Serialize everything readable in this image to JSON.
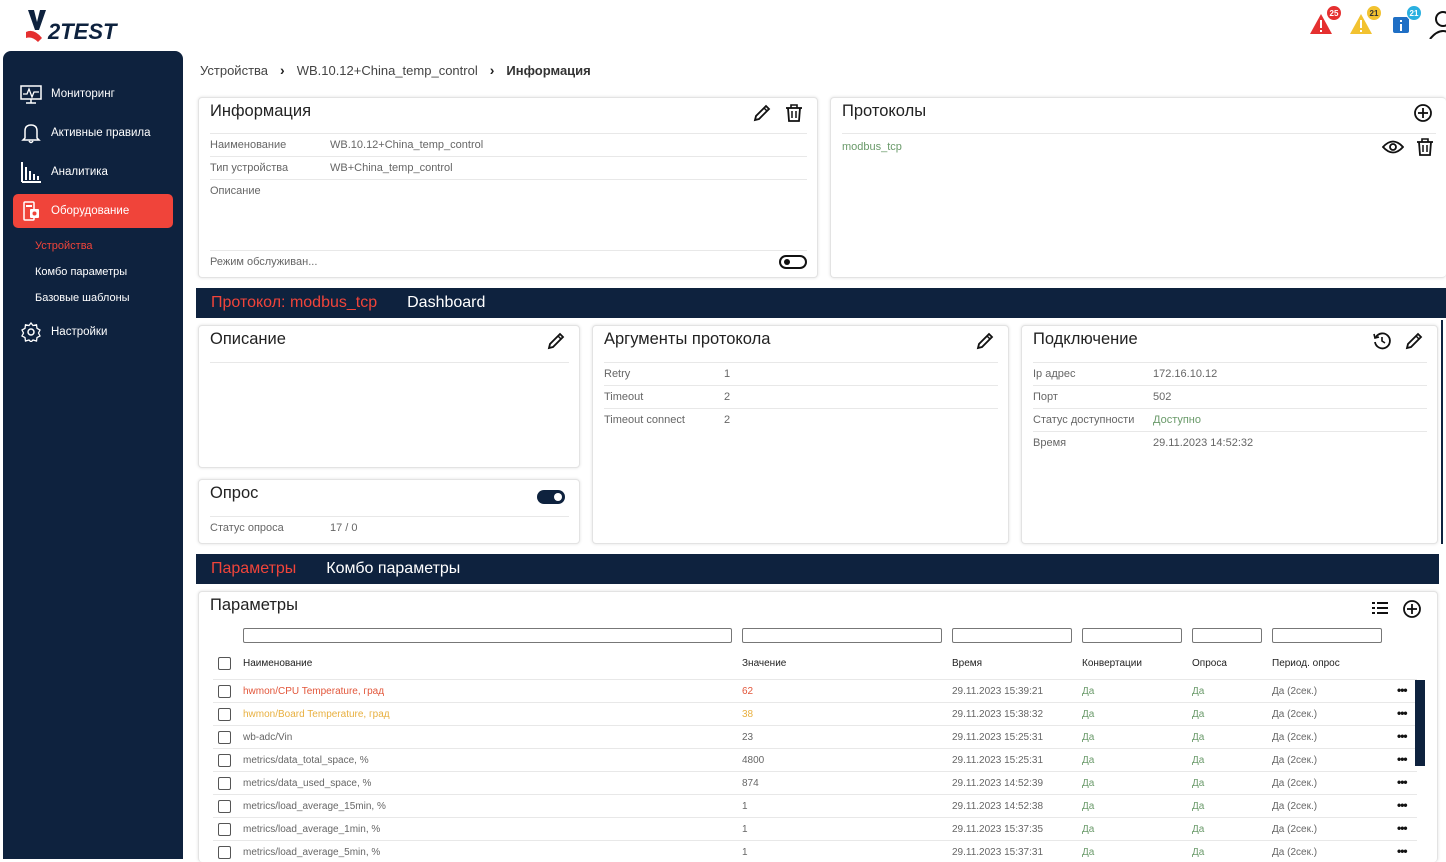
{
  "header": {
    "logo_text": "2TEST",
    "alerts": [
      {
        "icon": "error-triangle-icon",
        "count": "25",
        "color": "#e53030"
      },
      {
        "icon": "warning-triangle-icon",
        "count": "21",
        "color": "#f2c230"
      },
      {
        "icon": "info-square-icon",
        "count": "21",
        "color": "#1f6fc5"
      }
    ],
    "user_icon": "user-icon"
  },
  "sidebar": {
    "items": [
      {
        "label": "Мониторинг",
        "icon": "monitor-icon"
      },
      {
        "label": "Активные правила",
        "icon": "bell-icon"
      },
      {
        "label": "Аналитика",
        "icon": "bar-chart-icon"
      },
      {
        "label": "Оборудование",
        "icon": "equipment-icon",
        "active": true
      },
      {
        "label": "Настройки",
        "icon": "gear-icon"
      }
    ],
    "subitems": [
      {
        "label": "Устройства",
        "active": true
      },
      {
        "label": "Комбо параметры"
      },
      {
        "label": "Базовые шаблоны"
      }
    ]
  },
  "breadcrumb": [
    "Устройства",
    "WB.10.12+China_temp_control",
    "Информация"
  ],
  "info_card": {
    "title": "Информация",
    "rows": [
      {
        "key": "Наименование",
        "value": "WB.10.12+China_temp_control"
      },
      {
        "key": "Тип устройства",
        "value": "WB+China_temp_control"
      },
      {
        "key": "Описание",
        "value": ""
      }
    ],
    "maintenance_label": "Режим обслуживан...",
    "maintenance_on": false
  },
  "protocols_card": {
    "title": "Протоколы",
    "items": [
      "modbus_tcp"
    ]
  },
  "protocol_tabs": {
    "tabs": [
      "Протокол: modbus_tcp",
      "Dashboard"
    ],
    "active": 0
  },
  "description_card": {
    "title": "Описание"
  },
  "poll_card": {
    "title": "Опрос",
    "enabled": true,
    "status_label": "Статус опроса",
    "status_value": "17 / 0"
  },
  "args_card": {
    "title": "Аргументы протокола",
    "rows": [
      {
        "key": "Retry",
        "value": "1"
      },
      {
        "key": "Timeout",
        "value": "2"
      },
      {
        "key": "Timeout connect",
        "value": "2"
      }
    ]
  },
  "connection_card": {
    "title": "Подключение",
    "rows": [
      {
        "key": "Ip адрес",
        "value": "172.16.10.12"
      },
      {
        "key": "Порт",
        "value": "502"
      },
      {
        "key": "Статус доступности",
        "value": "Доступно"
      },
      {
        "key": "Время",
        "value": "29.11.2023 14:52:32"
      }
    ]
  },
  "param_tabs": {
    "tabs": [
      "Параметры",
      "Комбо параметры"
    ],
    "active": 0
  },
  "params_card": {
    "title": "Параметры",
    "columns": [
      "Наименование",
      "Значение",
      "Время",
      "Конвертации",
      "Опроса",
      "Период. опрос"
    ],
    "rows": [
      {
        "name": "hwmon/CPU Temperature, град",
        "value": "62",
        "time": "29.11.2023 15:39:21",
        "conv": "Да",
        "poll": "Да",
        "period": "Да (2сек.)",
        "color": "#e2563a"
      },
      {
        "name": "hwmon/Board Temperature, град",
        "value": "38",
        "time": "29.11.2023 15:38:32",
        "conv": "Да",
        "poll": "Да",
        "period": "Да (2сек.)",
        "color": "#e8b040"
      },
      {
        "name": "wb-adc/Vin",
        "value": "23",
        "time": "29.11.2023 15:25:31",
        "conv": "Да",
        "poll": "Да",
        "period": "Да (2сек.)",
        "color": "#666666"
      },
      {
        "name": "metrics/data_total_space, %",
        "value": "4800",
        "time": "29.11.2023 15:25:31",
        "conv": "Да",
        "poll": "Да",
        "period": "Да (2сек.)",
        "color": "#666666"
      },
      {
        "name": "metrics/data_used_space, %",
        "value": "874",
        "time": "29.11.2023 14:52:39",
        "conv": "Да",
        "poll": "Да",
        "period": "Да (2сек.)",
        "color": "#666666"
      },
      {
        "name": "metrics/load_average_15min, %",
        "value": "1",
        "time": "29.11.2023 14:52:38",
        "conv": "Да",
        "poll": "Да",
        "period": "Да (2сек.)",
        "color": "#666666"
      },
      {
        "name": "metrics/load_average_1min, %",
        "value": "1",
        "time": "29.11.2023 15:37:35",
        "conv": "Да",
        "poll": "Да",
        "period": "Да (2сек.)",
        "color": "#666666"
      },
      {
        "name": "metrics/load_average_5min, %",
        "value": "1",
        "time": "29.11.2023 15:37:31",
        "conv": "Да",
        "poll": "Да",
        "period": "Да (2сек.)",
        "color": "#666666"
      }
    ]
  },
  "colors": {
    "navy": "#0e223e",
    "accent": "#f0443a",
    "yes_green": "#6a9a6a"
  }
}
